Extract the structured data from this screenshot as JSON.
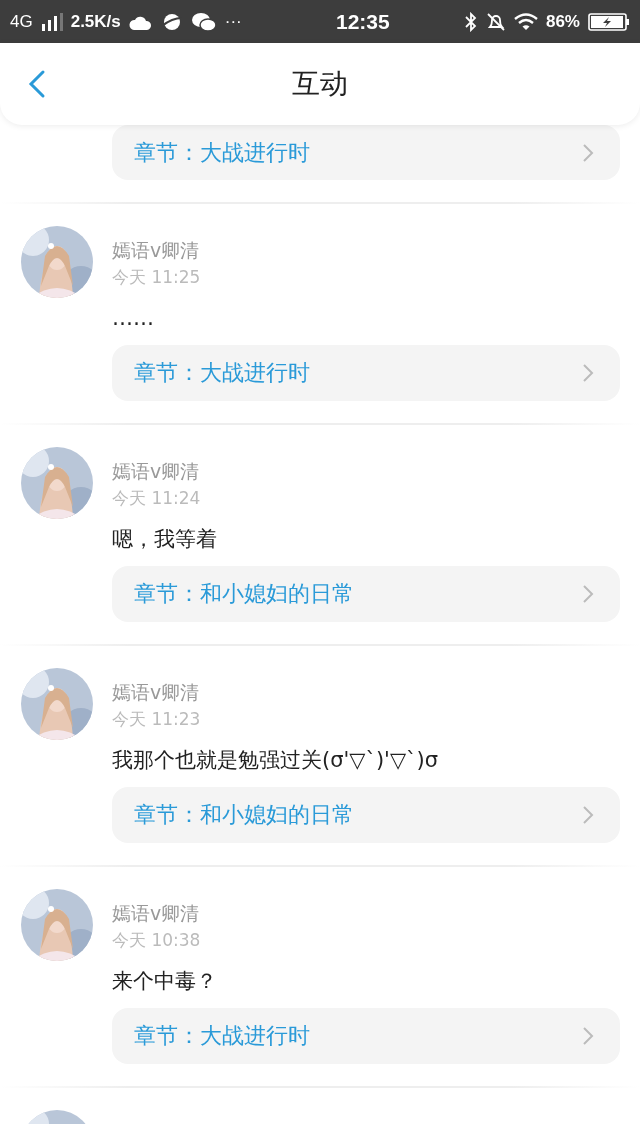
{
  "status_bar": {
    "network": "4G",
    "speed": "2.5K/s",
    "more": "···",
    "time": "12:35",
    "battery": "86%"
  },
  "header": {
    "title": "互动"
  },
  "top_chapter": {
    "label": "章节：大战进行时"
  },
  "comments": [
    {
      "user": "嫣语v卿清",
      "time": "今天 11:25",
      "text": "……",
      "chapter": "章节：大战进行时"
    },
    {
      "user": "嫣语v卿清",
      "time": "今天 11:24",
      "text": "嗯，我等着",
      "chapter": "章节：和小媳妇的日常"
    },
    {
      "user": "嫣语v卿清",
      "time": "今天 11:23",
      "text": "我那个也就是勉强过关(σ'▽`)'▽`)σ",
      "chapter": "章节：和小媳妇的日常"
    },
    {
      "user": "嫣语v卿清",
      "time": "今天 10:38",
      "text": "来个中毒？",
      "chapter": "章节：大战进行时"
    }
  ]
}
